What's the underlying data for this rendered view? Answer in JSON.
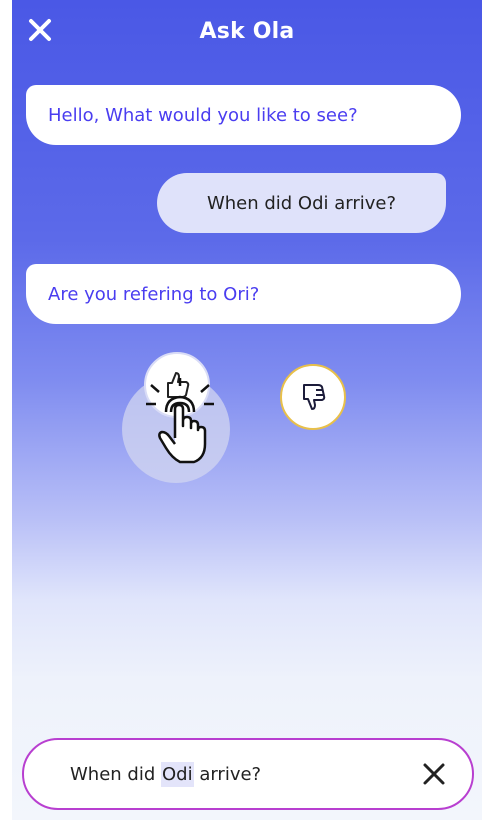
{
  "header": {
    "title": "Ask Ola",
    "close_icon": "close-icon"
  },
  "conversation": [
    {
      "role": "assistant",
      "text": "Hello, What would you like to see?"
    },
    {
      "role": "user",
      "text": "When did Odi arrive?"
    },
    {
      "role": "assistant",
      "text": "Are you refering to Ori?"
    }
  ],
  "feedback": {
    "up_icon": "thumbs-up-icon",
    "down_icon": "thumbs-down-icon"
  },
  "input": {
    "before": "When did ",
    "highlight": "Odi",
    "after": " arrive?",
    "clear_icon": "close-icon"
  },
  "colors": {
    "accent": "#4a3df0",
    "header_bg": "#4a58e6",
    "input_border": "#b83fd0",
    "thumbs_down_ring": "#e8c04a"
  }
}
